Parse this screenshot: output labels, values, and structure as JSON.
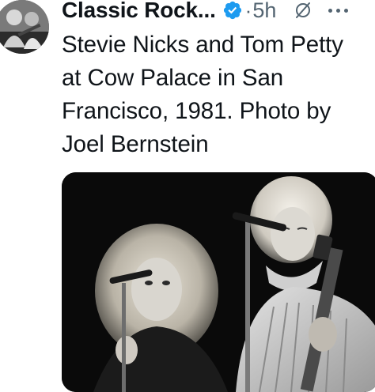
{
  "tweet": {
    "author": {
      "display_name": "Classic Rock...",
      "verified": true,
      "avatar_icon": "avatar-photo-icon"
    },
    "separator": "·",
    "timestamp": "5h",
    "text": "Stevie Nicks and Tom Petty\nat Cow Palace in San\nFrancisco, 1981. Photo by\nJoel Bernstein",
    "media": {
      "type": "photo",
      "colors": "black-and-white"
    }
  },
  "colors": {
    "text_primary": "#0f1419",
    "text_secondary": "#536471",
    "verified_blue": "#1d9bf0"
  },
  "icons": {
    "verified": "verified-badge-icon",
    "grok": "grok-icon",
    "more": "more-options-icon"
  }
}
